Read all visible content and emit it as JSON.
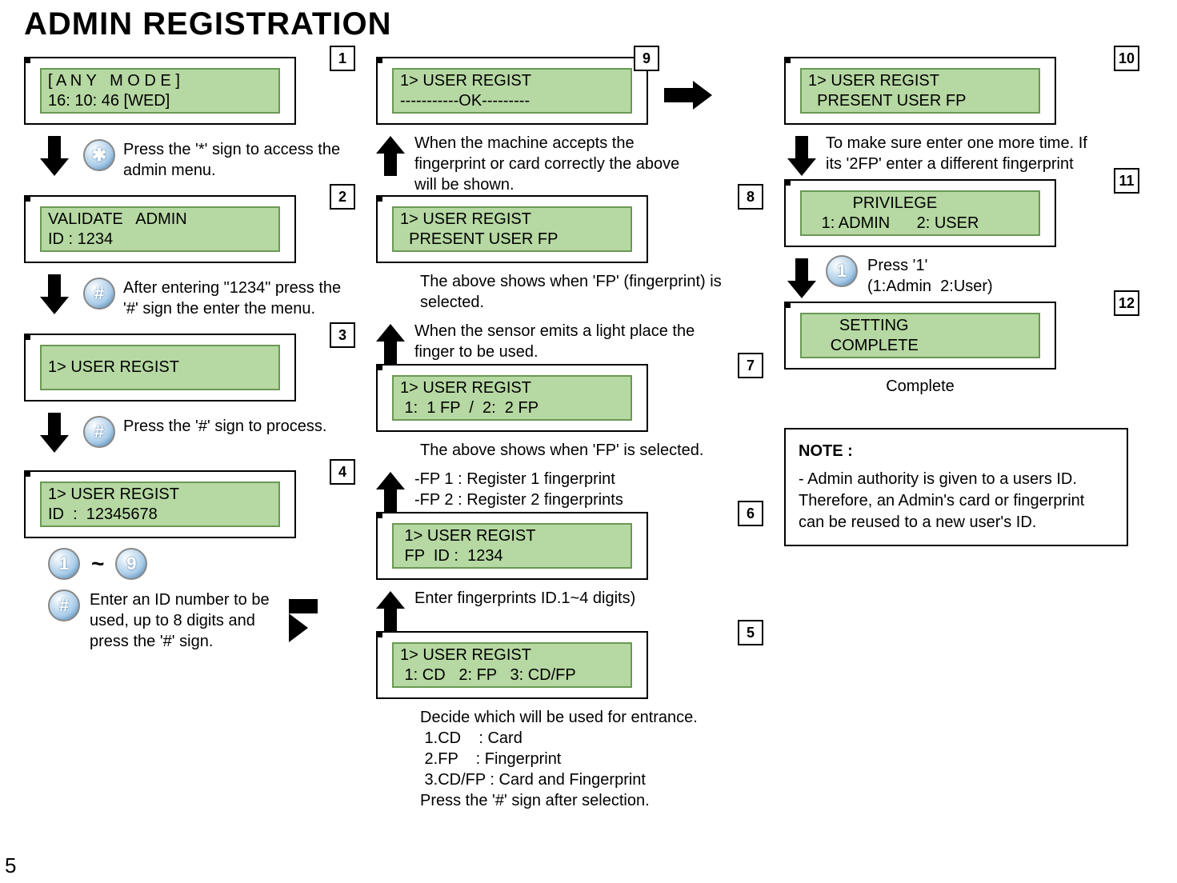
{
  "page_title": "ADMIN REGISTRATION",
  "page_number": "5",
  "note": {
    "title": "NOTE :",
    "body": "- Admin authority is given to a users ID. Therefore, an Admin's card or fingerprint can be reused to a new user's ID."
  },
  "col1": {
    "s1": {
      "num": "1",
      "line1": "[ A N Y   M O D E ]",
      "line2": "16: 10: 46 [WED]",
      "caption": "Press the '*' sign to access the admin menu.",
      "icon": "✱"
    },
    "s2": {
      "num": "2",
      "line1": "VALIDATE   ADMIN",
      "line2": "ID : 1234",
      "caption": "After entering \"1234\" press the '#' sign the enter the menu.",
      "icon": "#"
    },
    "s3": {
      "num": "3",
      "line1": "1> USER REGIST",
      "caption": "Press the '#' sign to process.",
      "icon": "#"
    },
    "s4": {
      "num": "4",
      "line1": "1> USER REGIST",
      "line2": "ID  :  12345678"
    },
    "digits": {
      "low": "1",
      "tilde": "~",
      "high": "9"
    },
    "s4b": {
      "icon": "#",
      "caption": "Enter an ID number to be used, up to 8 digits and press the '#' sign."
    }
  },
  "col2": {
    "s9": {
      "num": "9",
      "line1": "1> USER REGIST",
      "line2": "-----------OK---------"
    },
    "cap9": "When the machine accepts the fingerprint or card correctly the above will be shown.",
    "s8": {
      "num": "8",
      "line1": "1> USER REGIST",
      "line2": "  PRESENT USER FP"
    },
    "cap8a": "The above shows when 'FP' (fingerprint) is selected.",
    "cap8b": "When the sensor emits a light place the finger to be used.",
    "s7": {
      "num": "7",
      "line1": "1> USER REGIST",
      "line2": " 1:  1 FP  /  2:  2 FP"
    },
    "cap7a": "The above shows when 'FP' is selected.",
    "cap7b": "-FP 1 : Register 1 fingerprint",
    "cap7c": "-FP 2 : Register 2 fingerprints",
    "s6": {
      "num": "6",
      "line1": " 1> USER REGIST",
      "line2": " FP  ID :  1234"
    },
    "cap6": "Enter fingerprints ID.1~4 digits)",
    "s5": {
      "num": "5",
      "line1": "1> USER REGIST",
      "line2": " 1: CD   2: FP   3: CD/FP"
    },
    "cap5a": "Decide which will be used for entrance.",
    "cap5b": " 1.CD    : Card",
    "cap5c": " 2.FP    : Fingerprint",
    "cap5d": " 3.CD/FP : Card and Fingerprint",
    "cap5e": "Press the '#' sign after selection."
  },
  "col3": {
    "s10": {
      "num": "10",
      "line1": "1> USER REGIST",
      "line2": "  PRESENT USER FP"
    },
    "cap10": "To make sure enter one more time. If its '2FP' enter a different fingerprint",
    "s11": {
      "num": "11",
      "line1": "          PRIVILEGE",
      "line2": "   1: ADMIN      2: USER"
    },
    "cap11": "Press '1'\n(1:Admin  2:User)",
    "icon11": "1",
    "s12": {
      "num": "12",
      "line1": "       SETTING",
      "line2": "     COMPLETE"
    },
    "cap12": "Complete"
  }
}
